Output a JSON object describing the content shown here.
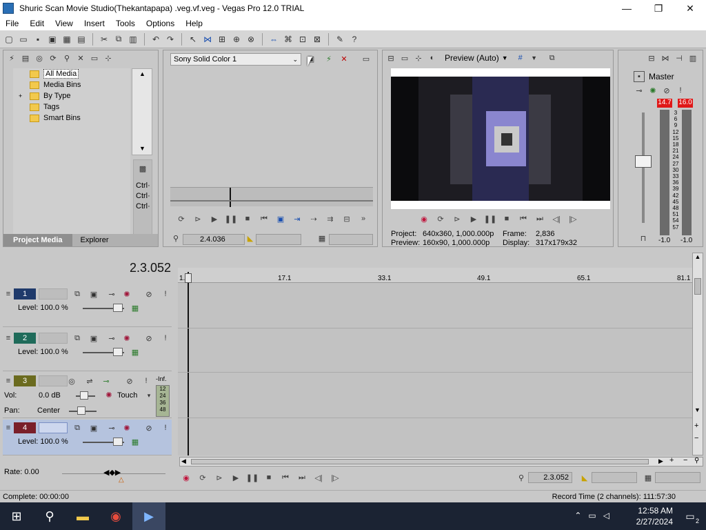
{
  "window": {
    "title": "Shuric Scan Movie Studio(Thekantapapa) .veg.vf.veg - Vegas Pro 12.0 TRIAL",
    "minimize": "—",
    "maximize": "❐",
    "close": "✕"
  },
  "menu": [
    "File",
    "Edit",
    "View",
    "Insert",
    "Tools",
    "Options",
    "Help"
  ],
  "project_media": {
    "tree": [
      {
        "label": "All Media",
        "selected": true
      },
      {
        "label": "Media Bins"
      },
      {
        "label": "By Type",
        "expand": "+"
      },
      {
        "label": "Tags"
      },
      {
        "label": "Smart Bins"
      }
    ],
    "side_keys": [
      "Ctrl·",
      "Ctrl·",
      "Ctrl·"
    ],
    "tabs": [
      "Project Media",
      "Explorer"
    ]
  },
  "trimmer": {
    "generator": "Sony Solid Color 1",
    "timecode": "2.4.036"
  },
  "preview": {
    "mode": "Preview (Auto)",
    "project_label": "Project:",
    "project_value": "640x360, 1,000.000p",
    "preview_label": "Preview:",
    "preview_value": "160x90, 1,000.000p",
    "frame_label": "Frame:",
    "frame_value": "2,836",
    "display_label": "Display:",
    "display_value": "317x179x32"
  },
  "master": {
    "label": "Master",
    "peak_left": "14.7",
    "peak_right": "16.0",
    "scale": [
      "3",
      "6",
      "9",
      "12",
      "15",
      "18",
      "21",
      "24",
      "27",
      "30",
      "33",
      "36",
      "39",
      "42",
      "45",
      "48",
      "51",
      "54",
      "57"
    ],
    "bottom_left": "-1.0",
    "bottom_right": "-1.0"
  },
  "timeline": {
    "cursor": "2.3.052",
    "ruler": [
      "1.1",
      "17.1",
      "33.1",
      "49.1",
      "65.1",
      "81.1"
    ],
    "tracks": [
      {
        "num": "1",
        "color": "#1f3a6b",
        "level": "Level: 100.0 %"
      },
      {
        "num": "2",
        "color": "#1f6b5a",
        "level": "Level: 100.0 %"
      },
      {
        "num": "3",
        "color": "#6b6b1f",
        "type": "audio",
        "vol_label": "Vol:",
        "vol_value": "0.0 dB",
        "touch": "Touch",
        "pan_label": "Pan:",
        "pan_value": "Center",
        "inf": "-Inf.",
        "meter": [
          "12",
          "24",
          "36",
          "48"
        ]
      },
      {
        "num": "4",
        "color": "#7a1f2a",
        "level": "Level: 100.0 %",
        "selected": true
      }
    ],
    "rate": "Rate: 0.00",
    "bottom_timecode": "2.3.052"
  },
  "status": {
    "left": "Complete: 00:00:00",
    "right": "Record Time (2 channels): 111:57:30"
  },
  "taskbar": {
    "time": "12:58 AM",
    "date": "2/27/2024",
    "notifications": "2"
  }
}
